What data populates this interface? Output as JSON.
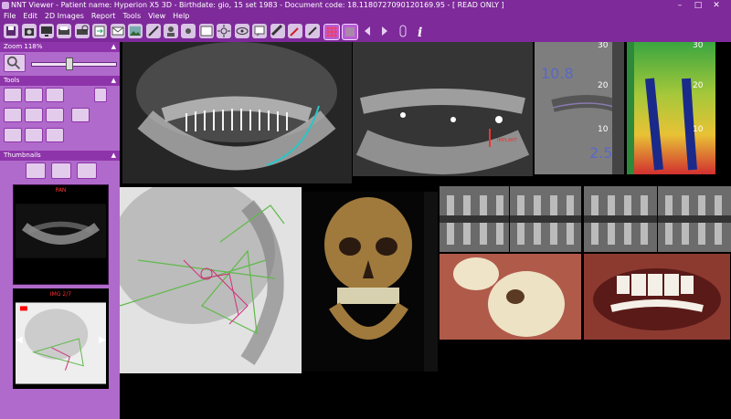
{
  "title": "NNT Viewer - Patient name: Hyperion X5 3D - Birthdate: gio, 15 set 1983 - Document code: 18.11807270901201​69.95 - [ READ ONLY ]",
  "window_controls": [
    "–",
    "□",
    "✕"
  ],
  "menu": [
    "File",
    "Edit",
    "2D Images",
    "Report",
    "Tools",
    "View",
    "Help"
  ],
  "toolbar_icons": [
    "save-icon",
    "camera-icon",
    "monitor-icon",
    "print-icon",
    "print-preview-icon",
    "export-icon",
    "email-icon",
    "image-import-icon",
    "measure-icon",
    "patient-icon",
    "brightness-icon",
    "image-icon",
    "sun-icon",
    "eye-icon",
    "annotation-icon",
    "ruler-icon",
    "pen-icon",
    "grid-icon",
    "zoom-3d-icon",
    "arrow-left-icon",
    "arrow-right-icon",
    "mouse-icon",
    "info-icon"
  ],
  "zoom": {
    "header": "Zoom 118%",
    "level": 0.45
  },
  "tools": {
    "header": "Tools"
  },
  "thumbnails": {
    "header": "Thumbnails",
    "items": [
      {
        "label": "PAN"
      },
      {
        "label": "IMG 2/7"
      }
    ]
  },
  "overlays": {
    "intraoral_left_value": "10.8",
    "intraoral_left_value2": "2.5",
    "scale_20": "20",
    "scale_30": "30",
    "scale_10": "10",
    "implant_label": "IMPLANT"
  },
  "colors": {
    "accent": "#7e2a9a",
    "sidebar": "#b06acb",
    "panel_header": "#8e34aa",
    "highlight": "#b85bd8"
  }
}
